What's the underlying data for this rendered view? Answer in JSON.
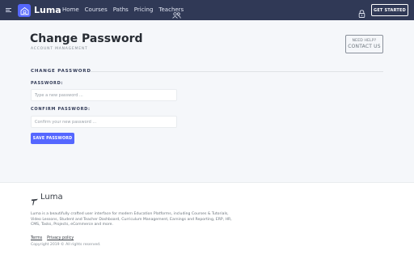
{
  "nav": {
    "brand": "Luma",
    "links": [
      "Home",
      "Courses",
      "Paths",
      "Pricing",
      "Teachers"
    ],
    "cta": "GET STARTED"
  },
  "header": {
    "title": "Change Password",
    "subtitle": "ACCOUNT MANAGEMENT",
    "help_line1": "NEED HELP?",
    "help_line2": "CONTACT US"
  },
  "form": {
    "section_title": "CHANGE PASSWORD",
    "password_label": "PASSWORD:",
    "password_placeholder": "Type a new password ...",
    "confirm_label": "CONFIRM PASSWORD:",
    "confirm_placeholder": "Confirm your new password ...",
    "save_label": "SAVE PASSWORD"
  },
  "footer": {
    "brand": "Luma",
    "description": "Luma is a beautifully crafted user interface for modern Education Platforms, including Courses & Tutorials, Video Lessons, Student and Teacher Dashboard, Curriculum Management, Earnings and Reporting, ERP, HR, CMS, Tasks, Projects, eCommerce and more.",
    "links": [
      "Terms",
      "Privacy policy"
    ],
    "copyright": "Copyright 2019 © All rights reserved."
  },
  "colors": {
    "navbar": "#303956",
    "accent": "#5567ff",
    "background": "#f5f7fa"
  },
  "icons": [
    "menu-icon",
    "luma-logo-icon",
    "users-icon",
    "lock-icon",
    "luma-footer-logo-icon"
  ]
}
